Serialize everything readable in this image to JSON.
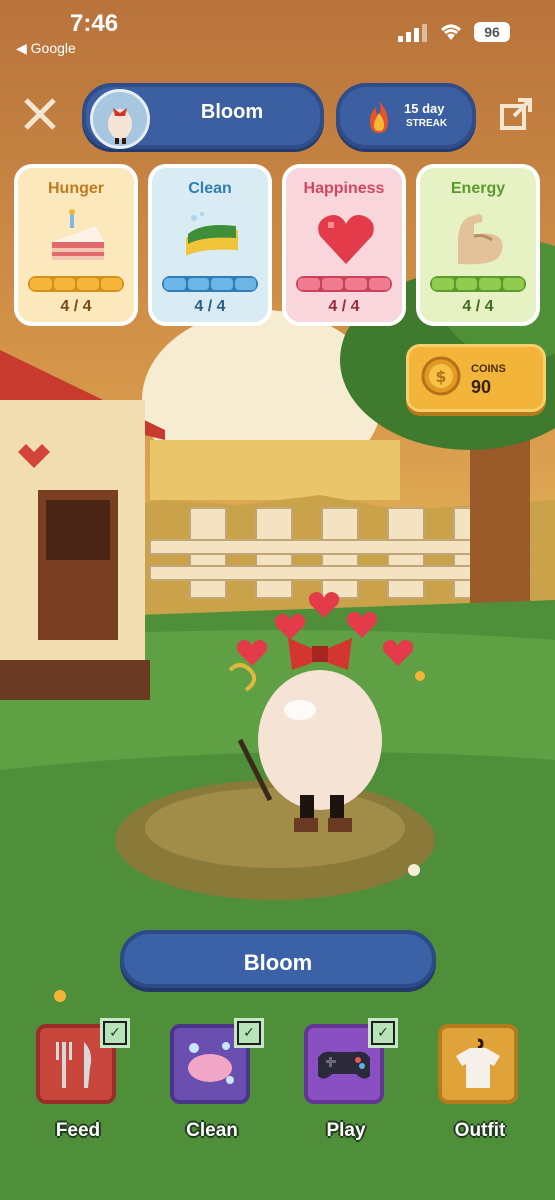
{
  "status_bar": {
    "time": "7:46",
    "back_label": "◀ Google",
    "battery": "96"
  },
  "header": {
    "pet_name": "Bloom",
    "streak_days": "15 day",
    "streak_label": "STREAK"
  },
  "stats": [
    {
      "title": "Hunger",
      "value": "4 / 4",
      "level": 1.0,
      "icon": "cake-icon"
    },
    {
      "title": "Clean",
      "value": "4 / 4",
      "level": 1.0,
      "icon": "sponge-icon"
    },
    {
      "title": "Happiness",
      "value": "4 / 4",
      "level": 1.0,
      "icon": "heart-icon"
    },
    {
      "title": "Energy",
      "value": "4 / 4",
      "level": 1.0,
      "icon": "muscle-icon"
    }
  ],
  "coins": {
    "label": "COINS",
    "amount": "90"
  },
  "pet_nameplate": "Bloom",
  "actions": [
    {
      "label": "Feed",
      "icon": "fork-knife-icon",
      "done": true,
      "color": "#c9463c"
    },
    {
      "label": "Clean",
      "icon": "soap-icon",
      "done": true,
      "color": "#6a4fb0"
    },
    {
      "label": "Play",
      "icon": "gamepad-icon",
      "done": true,
      "color": "#8a4fc0"
    },
    {
      "label": "Outfit",
      "icon": "shirt-icon",
      "done": false,
      "color": "#e0a33a"
    }
  ],
  "colors": {
    "sky": "#c98b4a",
    "grass": "#4f8f3a",
    "pill_blue": "#3b5fa1",
    "coin_gold": "#f2b53a"
  }
}
